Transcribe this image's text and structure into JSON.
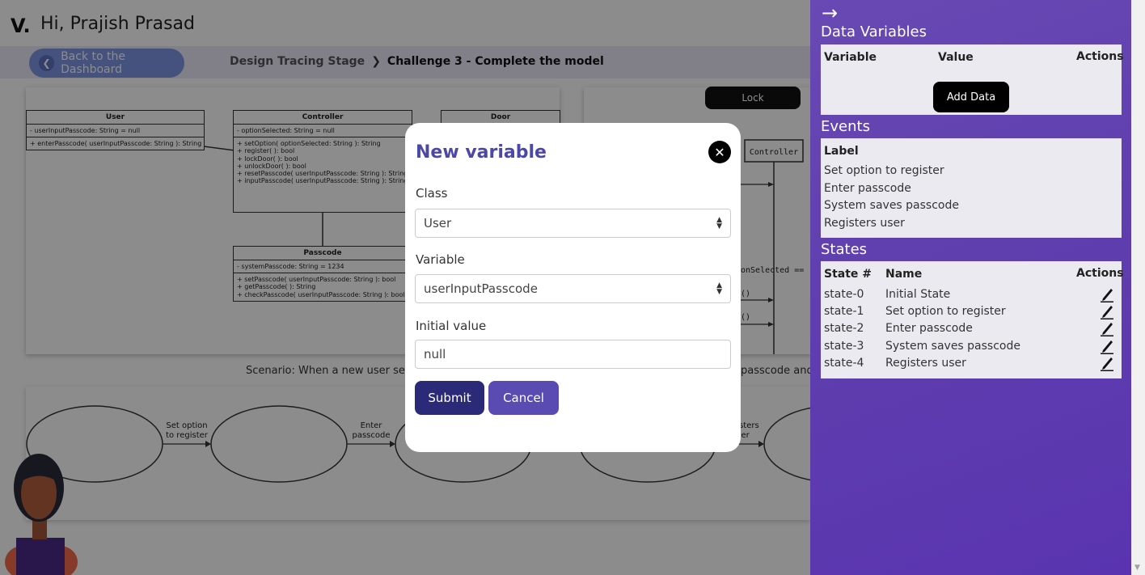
{
  "header": {
    "logo": "V.",
    "greeting": "Hi, Prajish Prasad",
    "back_button": "Back to the Dashboard",
    "breadcrumb": {
      "stage": "Design Tracing Stage",
      "separator": "❯",
      "challenge": "Challenge 3 - Complete the model"
    }
  },
  "class_diagram": {
    "classes": [
      {
        "name": "User",
        "attributes": [
          "- userInputPasscode: String = null"
        ],
        "methods": [
          "+ enterPasscode( userInputPasscode: String ): String"
        ]
      },
      {
        "name": "Controller",
        "attributes": [
          "- optionSelected: String = null"
        ],
        "methods": [
          "+ setOption( optionSelected: String ): String",
          "+ register( ): bool",
          "+ lockDoor( ): bool",
          "+ unlockDoor( ): bool",
          "+ resetPasscode( userInputPasscode: String ): String",
          "+ inputPasscode( userInputPasscode: String ): String"
        ]
      },
      {
        "name": "Door"
      },
      {
        "name": "Passcode",
        "attributes": [
          "- systemPasscode: String = 1234"
        ],
        "methods": [
          "+ setPasscode( userInputPasscode: String ): bool",
          "+ getPasscode( ): String",
          "+ checkPasscode( userInputPasscode: String ): bool"
        ]
      }
    ]
  },
  "sequence": {
    "lock_button": "Lock",
    "lifeline": "Controller",
    "guard": "onSelected == '",
    "msg1": "()",
    "msg2": "()"
  },
  "scenario": {
    "left": "Scenario:  When a new user sele",
    "right": "passcode and"
  },
  "state_diagram": {
    "transitions": [
      "Set option\nto register",
      "Enter\npasscode",
      "isters\nser"
    ]
  },
  "modal": {
    "title": "New variable",
    "close_icon": "close-icon",
    "class_label": "Class",
    "class_value": "User",
    "variable_label": "Variable",
    "variable_value": "userInputPasscode",
    "initial_label": "Initial value",
    "initial_value": "null",
    "submit": "Submit",
    "cancel": "Cancel"
  },
  "panel": {
    "collapse_icon": "arrow-right-icon",
    "data_variables": {
      "title": "Data Variables",
      "columns": [
        "Variable",
        "Value",
        "Actions"
      ],
      "add_button": "Add Data"
    },
    "events": {
      "title": "Events",
      "header": "Label",
      "items": [
        "Set option to register",
        "Enter passcode",
        "System saves passcode",
        "Registers user"
      ]
    },
    "states": {
      "title": "States",
      "columns": [
        "State #",
        "Name",
        "Actions"
      ],
      "rows": [
        {
          "id": "state-0",
          "name": "Initial State"
        },
        {
          "id": "state-1",
          "name": "Set option to register"
        },
        {
          "id": "state-2",
          "name": "Enter passcode"
        },
        {
          "id": "state-3",
          "name": "System saves passcode"
        },
        {
          "id": "state-4",
          "name": "Registers user"
        }
      ]
    }
  },
  "colors": {
    "panel": "#6347b2",
    "title": "#4b48a8",
    "submit": "#2b2a78",
    "cancel": "#5a4bb3"
  }
}
